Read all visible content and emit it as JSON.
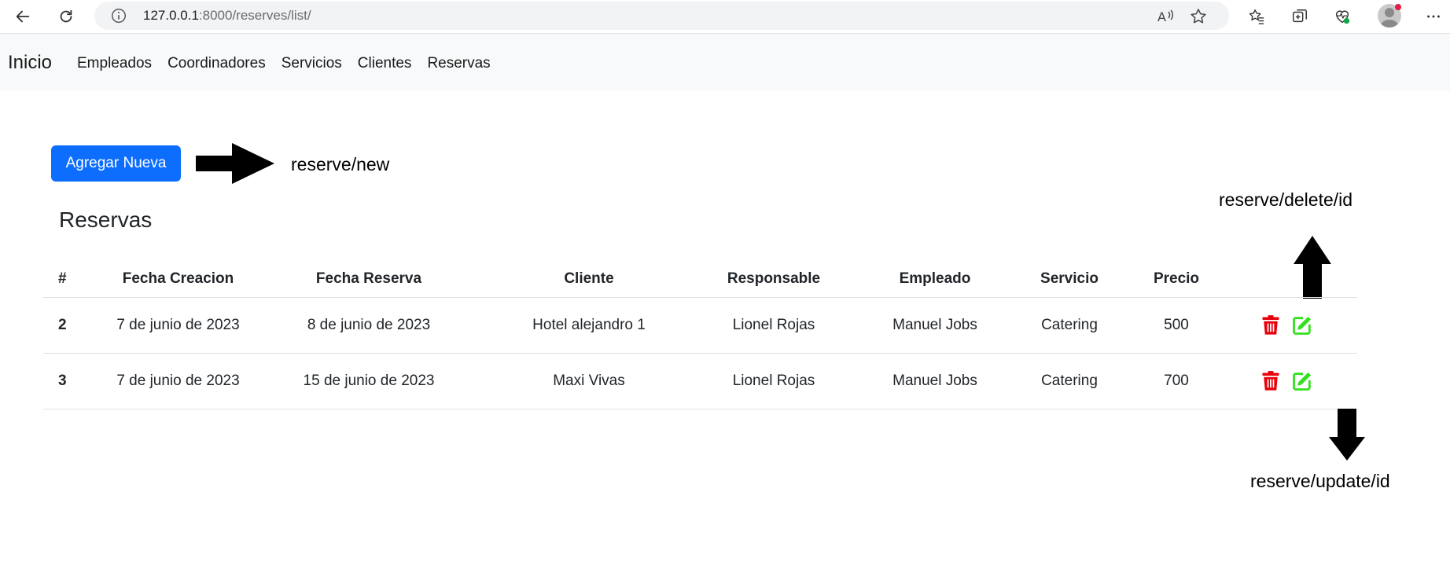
{
  "browser": {
    "url_host": "127.0.0.1",
    "url_rest": ":8000/reserves/list/",
    "icons": [
      "back-icon",
      "refresh-icon",
      "info-icon",
      "read-aloud-icon",
      "star-icon",
      "favorites-icon",
      "collections-icon",
      "browser-health-icon",
      "profile-icon",
      "more-icon"
    ]
  },
  "navbar": {
    "brand": "Inicio",
    "links": [
      "Empleados",
      "Coordinadores",
      "Servicios",
      "Clientes",
      "Reservas"
    ]
  },
  "main": {
    "add_button": "Agregar Nueva",
    "title": "Reservas",
    "annotations": {
      "new": "reserve/new",
      "delete": "reserve/delete/id",
      "update": "reserve/update/id"
    },
    "table": {
      "headers": [
        "#",
        "Fecha Creacion",
        "Fecha Reserva",
        "Cliente",
        "Responsable",
        "Empleado",
        "Servicio",
        "Precio"
      ],
      "rows": [
        [
          "2",
          "7 de junio de 2023",
          "8 de junio de 2023",
          "Hotel alejandro 1",
          "Lionel Rojas",
          "Manuel Jobs",
          "Catering",
          "500"
        ],
        [
          "3",
          "7 de junio de 2023",
          "15 de junio de 2023",
          "Maxi Vivas",
          "Lionel Rojas",
          "Manuel Jobs",
          "Catering",
          "700"
        ]
      ]
    }
  },
  "colors": {
    "primary": "#0d6efd",
    "delete": "#e8000b",
    "edit": "#33e01f",
    "navbar_bg": "#f8f9fa"
  }
}
